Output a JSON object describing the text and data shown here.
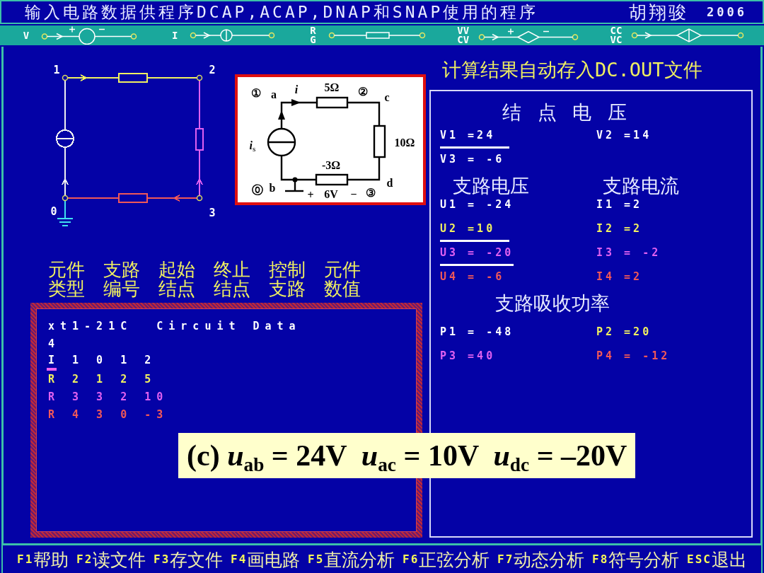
{
  "title_bar": {
    "title": "输入电路数据供程序DCAP,ACAP,DNAP和SNAP使用的程序",
    "author": "胡翔骏",
    "year": "2006"
  },
  "element_toolbar": [
    {
      "kind": "voltage-source",
      "label": [
        "V"
      ]
    },
    {
      "kind": "current-source",
      "label": [
        "I"
      ]
    },
    {
      "kind": "resistor",
      "label": [
        "R",
        "G"
      ]
    },
    {
      "kind": "controlled-voltage-source",
      "label": [
        "VV",
        "CV"
      ]
    },
    {
      "kind": "controlled-current-source",
      "label": [
        "CC",
        "VC"
      ]
    }
  ],
  "circuit_diagram": {
    "nodes": [
      "1",
      "2",
      "0",
      "3"
    ],
    "branches": [
      {
        "kind": "current-source",
        "color": "#f0f0f0"
      },
      {
        "kind": "resistor",
        "color": "#f0f060"
      },
      {
        "kind": "resistor",
        "color": "#e060f0"
      },
      {
        "kind": "resistor",
        "color": "#f05858"
      }
    ]
  },
  "textbook_figure": {
    "node_1_mark": "①",
    "terminal_a": "a",
    "current": "i",
    "resistor_top": "5Ω",
    "node_2_mark": "②",
    "terminal_c": "c",
    "source": "*i*$_{s}$",
    "resistor_right": "10Ω",
    "resistor_bottom": "-3Ω",
    "node_0_mark": "⓪",
    "terminal_b": "b",
    "terminal_d": "d",
    "plus_sign": "+",
    "voltage": "6V",
    "minus_sign": "−",
    "node_3_mark": "③"
  },
  "column_headers": [
    [
      "元件",
      "类型"
    ],
    [
      "支路",
      "编号"
    ],
    [
      "起始",
      "结点"
    ],
    [
      "终止",
      "结点"
    ],
    [
      "控制",
      "支路"
    ],
    [
      "元件",
      "数值"
    ]
  ],
  "data_listing": {
    "lines": [
      {
        "text": "xt1-21C  Circuit Data",
        "color": "#ffffff",
        "cursor": false
      },
      {
        "text": "4",
        "color": "#ffffff",
        "cursor": false
      },
      {
        "text": "I 1 0 1 2",
        "color": "#ffffff",
        "cursor": true
      },
      {
        "text": "R 2 1 2 5",
        "color": "#f0f060",
        "cursor": false
      },
      {
        "text": "R 3 3 2 10",
        "color": "#e060f0",
        "cursor": false
      },
      {
        "text": "R 4 3 0 -3",
        "color": "#f05858",
        "cursor": false
      }
    ]
  },
  "results": {
    "heading": "计算结果自动存入DC.OUT文件",
    "node_voltages": {
      "title": "结 点 电 压",
      "items": [
        {
          "text": "V1 =24",
          "underlined": true
        },
        {
          "text": "V2 =14",
          "underlined": false
        },
        {
          "text": "V3 = -6",
          "underlined": false
        }
      ]
    },
    "branch_voltages": {
      "title": "支路电压",
      "items": [
        {
          "text": "U1 = -24",
          "color": "#ffffff",
          "underlined": false
        },
        {
          "text": "U2 =10",
          "color": "#f0f060",
          "underlined": true
        },
        {
          "text": "U3 = -20",
          "color": "#e060f0",
          "underlined": true
        },
        {
          "text": "U4 = -6",
          "color": "#f05858",
          "underlined": false
        }
      ]
    },
    "branch_currents": {
      "title": "支路电流",
      "items": [
        {
          "text": "I1 =2",
          "color": "#ffffff"
        },
        {
          "text": "I2 =2",
          "color": "#f0f060"
        },
        {
          "text": "I3 = -2",
          "color": "#e060f0"
        },
        {
          "text": "I4 =2",
          "color": "#f05858"
        }
      ]
    },
    "branch_powers": {
      "title": "支路吸收功率",
      "items": [
        {
          "text": "P1 = -48",
          "color": "#ffffff"
        },
        {
          "text": "P2 =20",
          "color": "#f0f060"
        },
        {
          "text": "P3 =40",
          "color": "#e060f0"
        },
        {
          "text": "P4 = -12",
          "color": "#f05858"
        }
      ]
    }
  },
  "caption": "(c) *u*$_{ab}$ = 24V  *u*$_{ac}$ = 10V  *u*$_{dc}$ = –20V",
  "function_keys": [
    {
      "key": "F1",
      "label": "帮助"
    },
    {
      "key": "F2",
      "label": "读文件"
    },
    {
      "key": "F3",
      "label": "存文件"
    },
    {
      "key": "F4",
      "label": "画电路"
    },
    {
      "key": "F5",
      "label": "直流分析"
    },
    {
      "key": "F6",
      "label": "正弦分析"
    },
    {
      "key": "F7",
      "label": "动态分析"
    },
    {
      "key": "F8",
      "label": "符号分析"
    },
    {
      "key": "ESC",
      "label": "退出"
    }
  ]
}
